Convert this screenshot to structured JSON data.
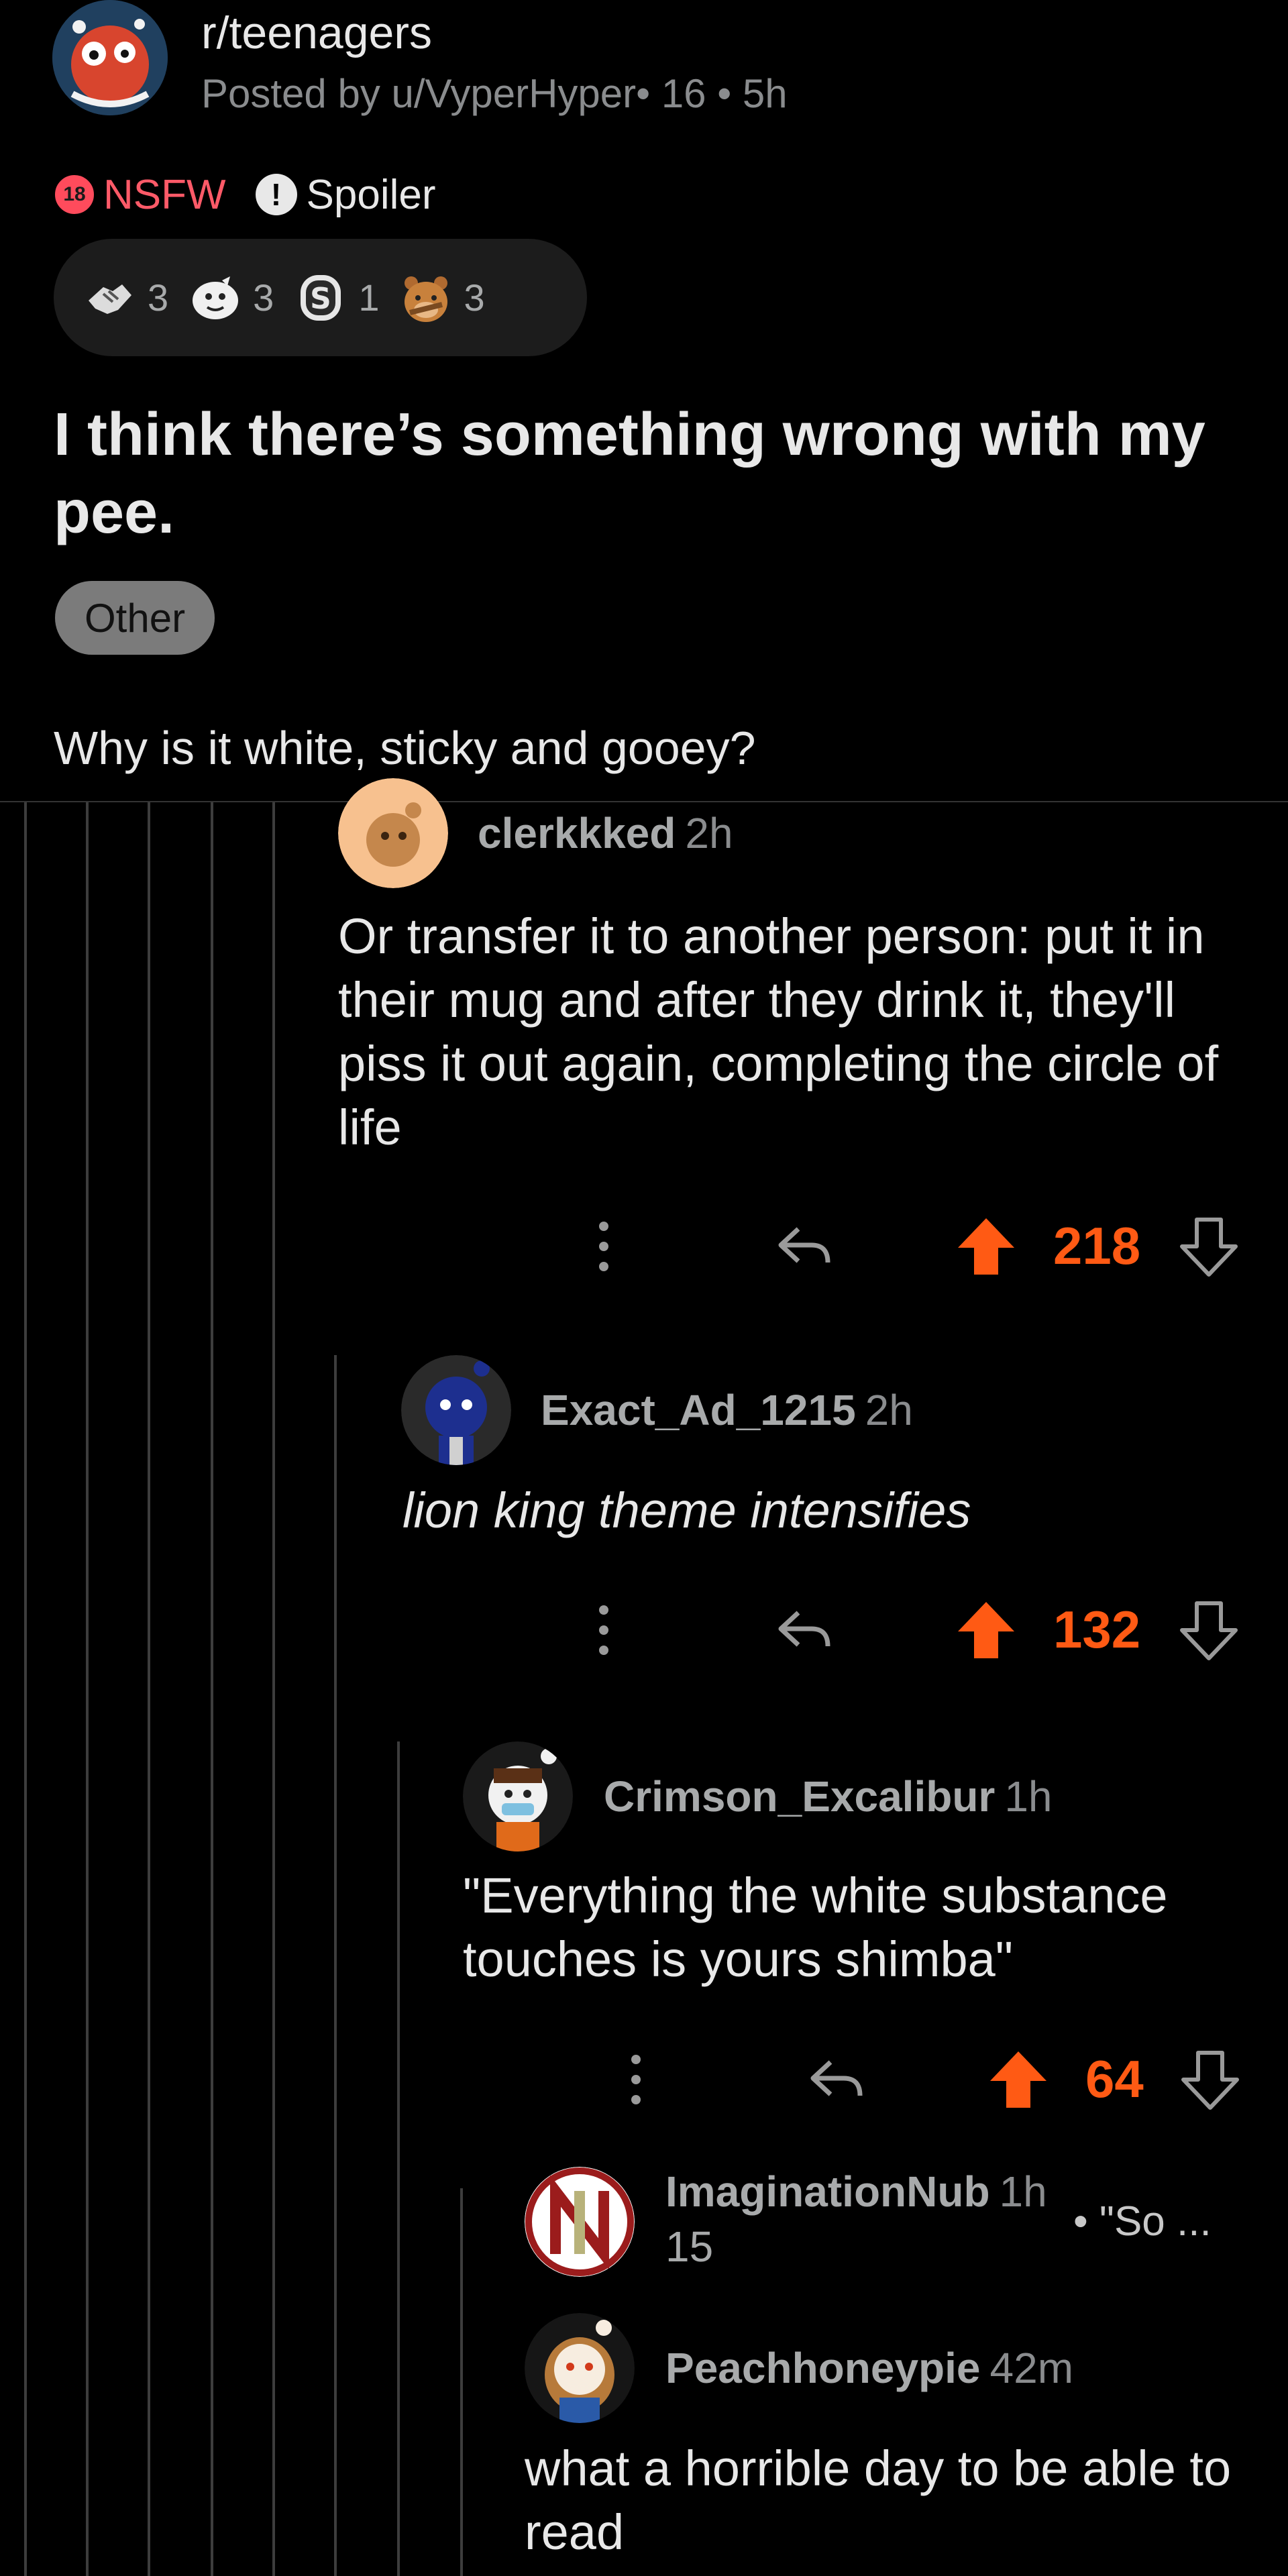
{
  "post": {
    "subreddit": "r/teenagers",
    "posted_by_prefix": "Posted by ",
    "author": "u/VyperHyper",
    "author_flair": "16",
    "age": "5h",
    "tags": {
      "nsfw_badge": "18",
      "nsfw": "NSFW",
      "spoiler_icon": "!",
      "spoiler": "Spoiler"
    },
    "awards": [
      {
        "icon": "handshake-award-icon",
        "count": "3"
      },
      {
        "icon": "face-award-icon",
        "count": "3"
      },
      {
        "icon": "silver-coin-award-icon",
        "count": "1"
      },
      {
        "icon": "bear-award-icon",
        "count": "3"
      }
    ],
    "title": "I think there’s something wrong with my pee.",
    "flair": "Other",
    "body": "Why is it white, sticky and gooey?"
  },
  "comments": [
    {
      "username": "clerkkked",
      "time": "2h",
      "body": "Or transfer it to another person: put it in their mug and after they drink it, they'll piss it out again, completing the circle of life",
      "score": "218"
    },
    {
      "username": "Exact_Ad_1215",
      "time": "2h",
      "body": "lion king theme intensifies",
      "score": "132"
    },
    {
      "username": "Crimson_Excalibur",
      "time": "1h",
      "body": "\"Everything the white substance touches is yours shimba\"",
      "score": "64"
    },
    {
      "username": "ImaginationNub",
      "time": "1h",
      "score": "15",
      "preview": "• \"So ..."
    },
    {
      "username": "Peachhoneypie",
      "time": "42m",
      "body": "what a horrible day to be able to read"
    }
  ],
  "colors": {
    "upvote": "#ff5a14",
    "nsfw": "#ff4b5c",
    "background": "#000000",
    "thread_line": "#3d3d3d"
  }
}
